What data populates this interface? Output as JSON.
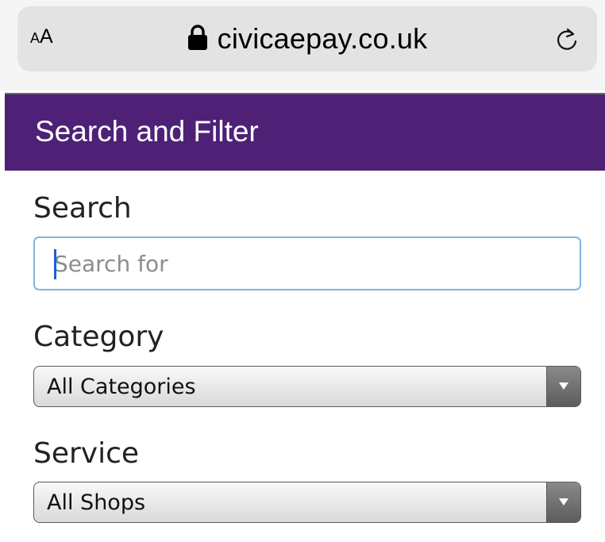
{
  "browser": {
    "text_size_small": "A",
    "text_size_large": "A",
    "url": "civicaepay.co.uk",
    "lock_icon": "lock-icon",
    "reload_icon": "reload-icon"
  },
  "panel": {
    "title": "Search and Filter",
    "header_color": "#4e2177"
  },
  "search": {
    "label": "Search",
    "value": "",
    "placeholder": "Search for"
  },
  "category": {
    "label": "Category",
    "selected": "All Categories"
  },
  "service": {
    "label": "Service",
    "selected": "All Shops"
  }
}
